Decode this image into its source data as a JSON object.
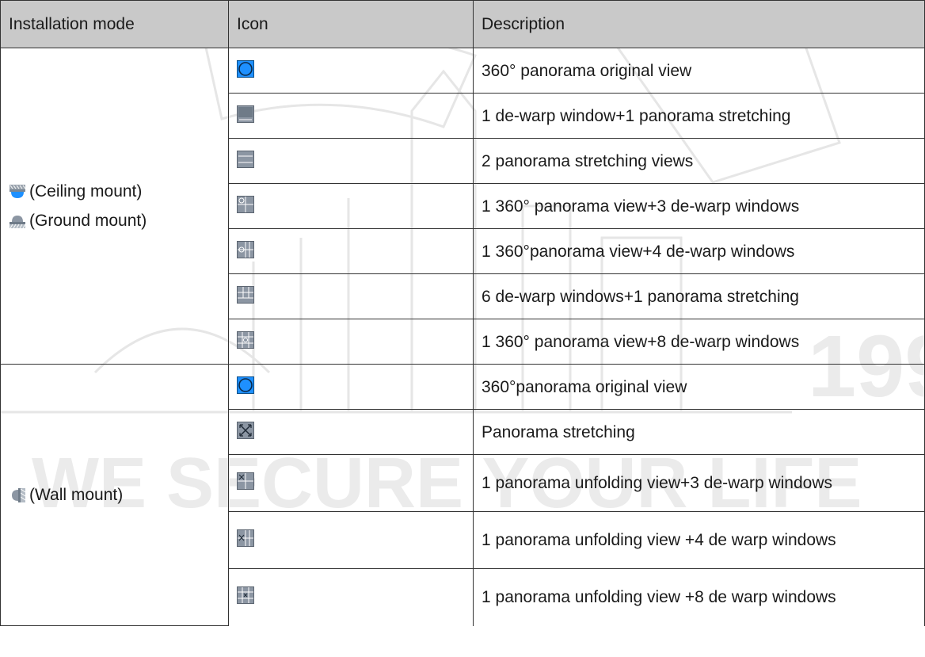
{
  "table": {
    "headers": [
      "Installation mode",
      "Icon",
      "Description"
    ],
    "groups": [
      {
        "modes": [
          {
            "icon": "ceiling-mount-icon",
            "label": "(Ceiling mount)"
          },
          {
            "icon": "ground-mount-icon",
            "label": "(Ground mount)"
          }
        ],
        "rows": [
          {
            "icon": "panorama-original-view-icon",
            "description": "360° panorama original view"
          },
          {
            "icon": "one-dewarp-panorama-stretching-icon",
            "description": "1 de-warp window+1 panorama stretching"
          },
          {
            "icon": "two-panorama-stretching-icon",
            "description": "2 panorama stretching views"
          },
          {
            "icon": "panorama-three-dewarp-icon",
            "description": "1 360° panorama view+3 de-warp windows"
          },
          {
            "icon": "panorama-four-dewarp-icon",
            "description": "1 360°panorama view+4 de-warp windows"
          },
          {
            "icon": "six-dewarp-panorama-stretching-icon",
            "description": "6 de-warp windows+1 panorama stretching"
          },
          {
            "icon": "panorama-eight-dewarp-icon",
            "description": "1 360° panorama view+8 de-warp windows"
          }
        ]
      },
      {
        "modes": [
          {
            "icon": "wall-mount-icon",
            "label": "(Wall mount)"
          }
        ],
        "rows": [
          {
            "icon": "panorama-original-view-icon",
            "description": "360°panorama original view"
          },
          {
            "icon": "panorama-stretching-icon",
            "description": "Panorama stretching"
          },
          {
            "icon": "unfolding-three-dewarp-icon",
            "description": "1 panorama unfolding view+3 de-warp windows"
          },
          {
            "icon": "unfolding-four-dewarp-icon",
            "description": "1 panorama unfolding view +4 de warp windows"
          },
          {
            "icon": "unfolding-eight-dewarp-icon",
            "description": "1 panorama unfolding view +8 de warp windows"
          }
        ]
      }
    ]
  },
  "watermark": {
    "slogan": "WE SECURE YOUR LIFE",
    "digits": "199"
  },
  "colors": {
    "header_bg": "#c9c9c9",
    "grid": "#333333",
    "icon_blue": "#1e90ff",
    "icon_gray": "#8c96a3"
  }
}
